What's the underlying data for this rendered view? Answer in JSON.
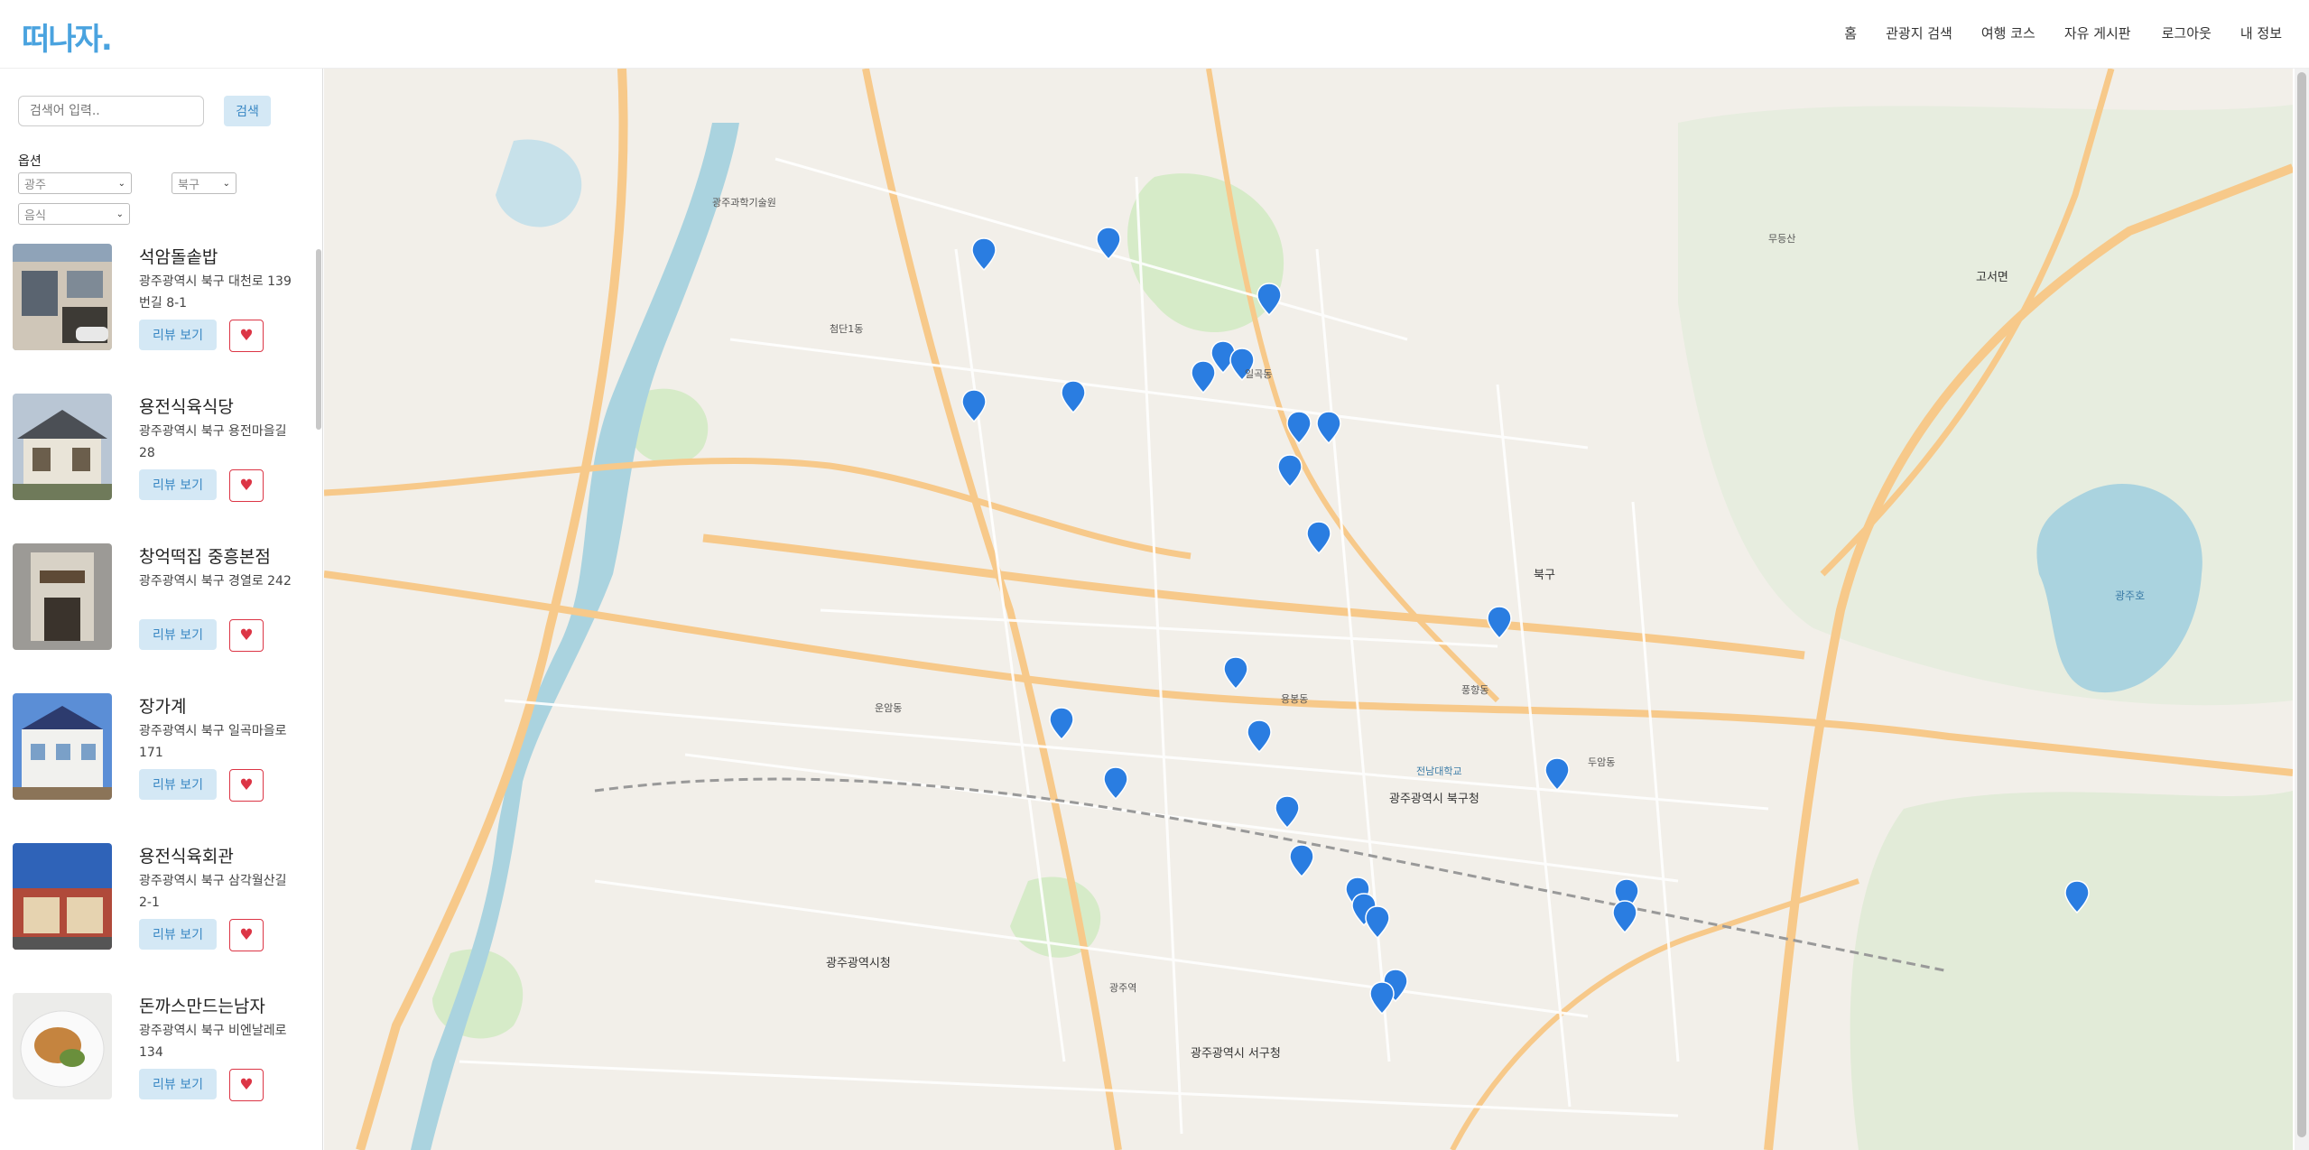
{
  "header": {
    "logo": "떠나자.",
    "nav": [
      {
        "label": "홈"
      },
      {
        "label": "관광지 검색"
      },
      {
        "label": "여행 코스"
      },
      {
        "label": "자유 게시판"
      },
      {
        "label": "로그아웃"
      },
      {
        "label": "내 정보"
      }
    ]
  },
  "sidebar": {
    "search": {
      "placeholder": "검색어 입력..",
      "button_label": "검색"
    },
    "options_label": "옵션",
    "selects": {
      "city": "광주",
      "district": "북구",
      "category": "음식"
    },
    "review_label": "리뷰 보기",
    "heart_glyph": "♥",
    "items": [
      {
        "name": "석암돌솥밥",
        "address": "광주광역시 북구 대천로 139번길 8-1"
      },
      {
        "name": "용전식육식당",
        "address": "광주광역시 북구 용전마을길 28"
      },
      {
        "name": "창억떡집 중흥본점",
        "address": "광주광역시 북구 경열로 242"
      },
      {
        "name": "장가계",
        "address": "광주광역시 북구 일곡마을로 171"
      },
      {
        "name": "용전식육회관",
        "address": "광주광역시 북구 삼각월산길 2-1"
      },
      {
        "name": "돈까스만드는남자",
        "address": "광주광역시 북구 비엔날레로 134"
      }
    ]
  },
  "map": {
    "labels": [
      "광주광역시 북구청",
      "광주광역시청",
      "광주광역시 서구청",
      "북구",
      "고서면",
      "광주호",
      "광주과학기술원",
      "전남대학교",
      "광주역",
      "무등산",
      "첨단1동",
      "운암동",
      "일곡동",
      "용봉동",
      "풍향동",
      "두암동"
    ],
    "colors": {
      "road_major": "#f7c98a",
      "road_minor": "#ffffff",
      "water": "#aad3df",
      "park": "#d6ebc8",
      "marker": "#2a7de1"
    }
  }
}
